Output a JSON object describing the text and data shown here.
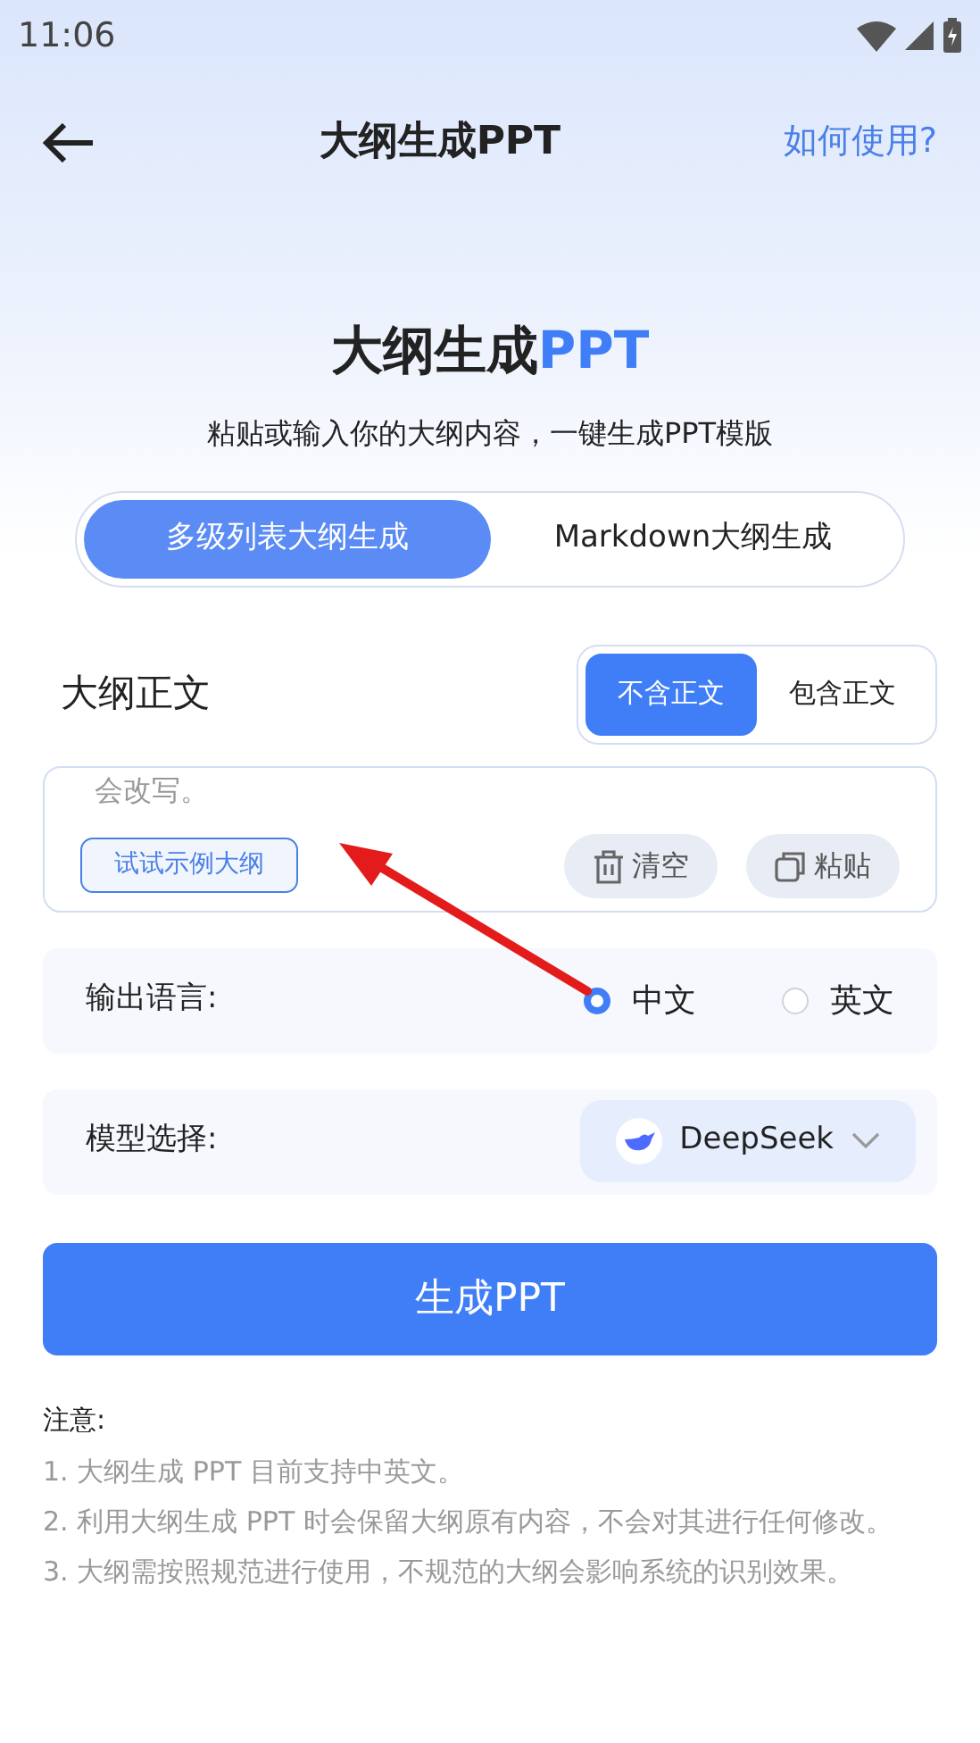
{
  "status_bar": {
    "time": "11:06"
  },
  "header": {
    "title": "大纲生成PPT",
    "help_link": "如何使用?"
  },
  "hero": {
    "title": "大纲生成",
    "title_accent": "PPT",
    "subtitle": "粘贴或输入你的大纲内容，一键生成PPT模版"
  },
  "mode_tabs": [
    {
      "label": "多级列表大纲生成",
      "selected": true
    },
    {
      "label": "Markdown大纲生成",
      "selected": false
    }
  ],
  "outline": {
    "label": "大纲正文",
    "content_tabs": [
      {
        "label": "不含正文",
        "selected": true
      },
      {
        "label": "包含正文",
        "selected": false
      }
    ],
    "text": "会改写。",
    "sample_button": "试试示例大纲",
    "actions": [
      {
        "kind": "clear",
        "label": "清空"
      },
      {
        "kind": "paste",
        "label": "粘贴"
      }
    ]
  },
  "language": {
    "label": "输出语言:",
    "options": [
      {
        "label": "中文",
        "selected": true
      },
      {
        "label": "英文",
        "selected": false
      }
    ]
  },
  "model": {
    "label": "模型选择:",
    "value": "DeepSeek"
  },
  "generate_button": "生成PPT",
  "notes": {
    "title": "注意:",
    "items": [
      "1. 大纲生成 PPT 目前支持中英文。",
      "2. 利用大纲生成 PPT 时会保留大纲原有内容，不会对其进行任何修改。",
      "3. 大纲需按照规范进行使用，不规范的大纲会影响系统的识别效果。"
    ]
  }
}
